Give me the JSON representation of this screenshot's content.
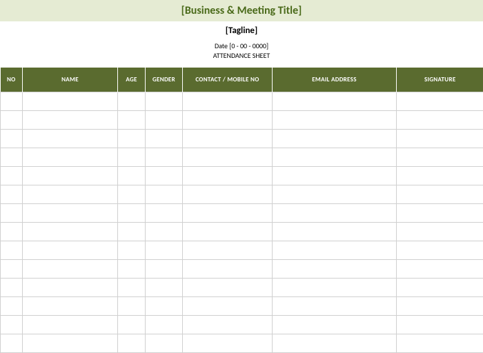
{
  "header": {
    "title": "[Business & Meeting  Title]",
    "tagline": "[Tagline]",
    "date_line": "Date [0 - 00 - 0000]",
    "sheet_label": "ATTENDANCE SHEET"
  },
  "table": {
    "columns": {
      "no": "NO",
      "name": "NAME",
      "age": "AGE",
      "gender": "GENDER",
      "contact": "CONTACT / MOBILE NO",
      "email": "EMAIL ADDRESS",
      "signature": "SIGNATURE"
    },
    "row_count": 14
  }
}
